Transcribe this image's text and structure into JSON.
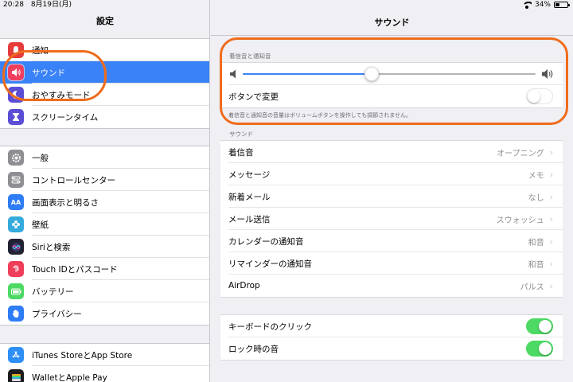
{
  "status_bar": {
    "time": "20:28",
    "date": "8月19日(月)",
    "battery": "34%",
    "battery_level": 0.34
  },
  "left": {
    "title": "設定",
    "group1": [
      {
        "label": "通知",
        "icon": "bell-icon",
        "color": "#e53b3b",
        "selected": false
      },
      {
        "label": "サウンド",
        "icon": "speaker-icon",
        "color": "#f23f5f",
        "selected": true
      },
      {
        "label": "おやすみモード",
        "icon": "moon-icon",
        "color": "#5b4ed5",
        "selected": false
      },
      {
        "label": "スクリーンタイム",
        "icon": "hourglass-icon",
        "color": "#5b4ed5",
        "selected": false
      }
    ],
    "group2": [
      {
        "label": "一般",
        "icon": "gear-icon",
        "color": "#8e8e93"
      },
      {
        "label": "コントロールセンター",
        "icon": "toggles-icon",
        "color": "#8e8e93"
      },
      {
        "label": "画面表示と明るさ",
        "icon": "aa-icon",
        "color": "#2e7cf6",
        "glyph": "AA"
      },
      {
        "label": "壁紙",
        "icon": "flower-icon",
        "color": "#35aadc"
      },
      {
        "label": "Siriと検索",
        "icon": "siri-icon",
        "color": "#222233"
      },
      {
        "label": "Touch IDとパスコード",
        "icon": "fingerprint-icon",
        "color": "#ef3e59"
      },
      {
        "label": "バッテリー",
        "icon": "battery-icon",
        "color": "#4cd964"
      },
      {
        "label": "プライバシー",
        "icon": "hand-icon",
        "color": "#2e7cf6"
      }
    ],
    "group3": [
      {
        "label": "iTunes StoreとApp Store",
        "icon": "appstore-icon",
        "color": "#2e8ff6"
      },
      {
        "label": "WalletとApple Pay",
        "icon": "wallet-icon",
        "color": "#1c1c1e"
      }
    ]
  },
  "right": {
    "title": "サウンド",
    "ringer_section": {
      "header": "着信音と通知音",
      "volume_level": 0.44,
      "change_with_buttons": {
        "label": "ボタンで変更",
        "on": false
      },
      "footer": "着信音と通知音の音量はボリュームボタンを操作しても調節されません。"
    },
    "sounds_section": {
      "header": "サウンド",
      "items": [
        {
          "label": "着信音",
          "value": "オープニング"
        },
        {
          "label": "メッセージ",
          "value": "メモ"
        },
        {
          "label": "新着メール",
          "value": "なし"
        },
        {
          "label": "メール送信",
          "value": "スウォッシュ"
        },
        {
          "label": "カレンダーの通知音",
          "value": "和音"
        },
        {
          "label": "リマインダーの通知音",
          "value": "和音"
        },
        {
          "label": "AirDrop",
          "value": "パルス"
        }
      ]
    },
    "toggles_section": [
      {
        "label": "キーボードのクリック",
        "on": true
      },
      {
        "label": "ロック時の音",
        "on": true
      }
    ]
  },
  "colors": {
    "accent": "#3a82f7",
    "annotation": "#ef6c1c",
    "toggle_on": "#4cd964"
  }
}
